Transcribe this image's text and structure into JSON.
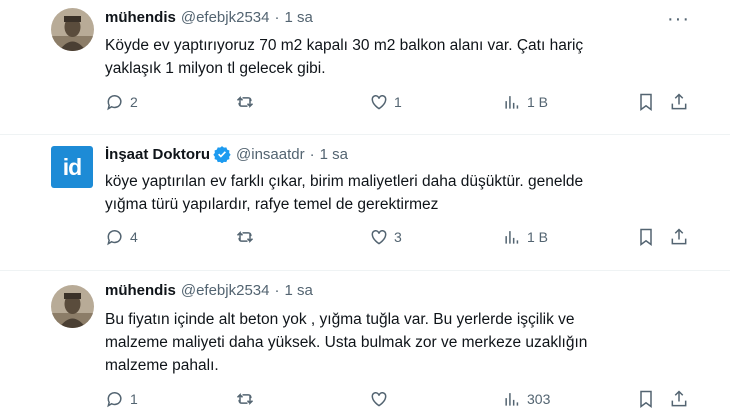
{
  "tweets": [
    {
      "name": "mühendis",
      "handle": "@efebjk2534",
      "time": "1 sa",
      "lines": [
        "Köyde ev yaptırıyoruz 70 m2 kapalı 30 m2 balkon alanı var. Çatı hariç",
        "yaklaşık 1 milyon tl gelecek gibi."
      ],
      "replies": "2",
      "retweets": "",
      "likes": "1",
      "views": "1 B"
    },
    {
      "name": "İnşaat Doktoru",
      "handle": "@insaatdr",
      "time": "1 sa",
      "logo_text": "id",
      "lines": [
        "köye yaptırılan ev farklı çıkar, birim maliyetleri daha düşüktür. genelde",
        "yığma türü yapılardır, rafye temel de gerektirmez"
      ],
      "replies": "4",
      "retweets": "",
      "likes": "3",
      "views": "1 B"
    },
    {
      "name": "mühendis",
      "handle": "@efebjk2534",
      "time": "1 sa",
      "lines": [
        "Bu fiyatın içinde alt beton yok , yığma tuğla var. Bu yerlerde işçilik ve",
        "malzeme maliyeti daha yüksek. Usta bulmak zor ve merkeze uzaklığın",
        "malzeme pahalı."
      ],
      "replies": "1",
      "retweets": "",
      "likes": "",
      "views": "303"
    }
  ],
  "separator": "·",
  "more_glyph": "···",
  "colors": {
    "text": "#0f1419",
    "secondary": "#536471",
    "verified": "#1d9bf0",
    "logo_bg": "#1d8bd6"
  }
}
